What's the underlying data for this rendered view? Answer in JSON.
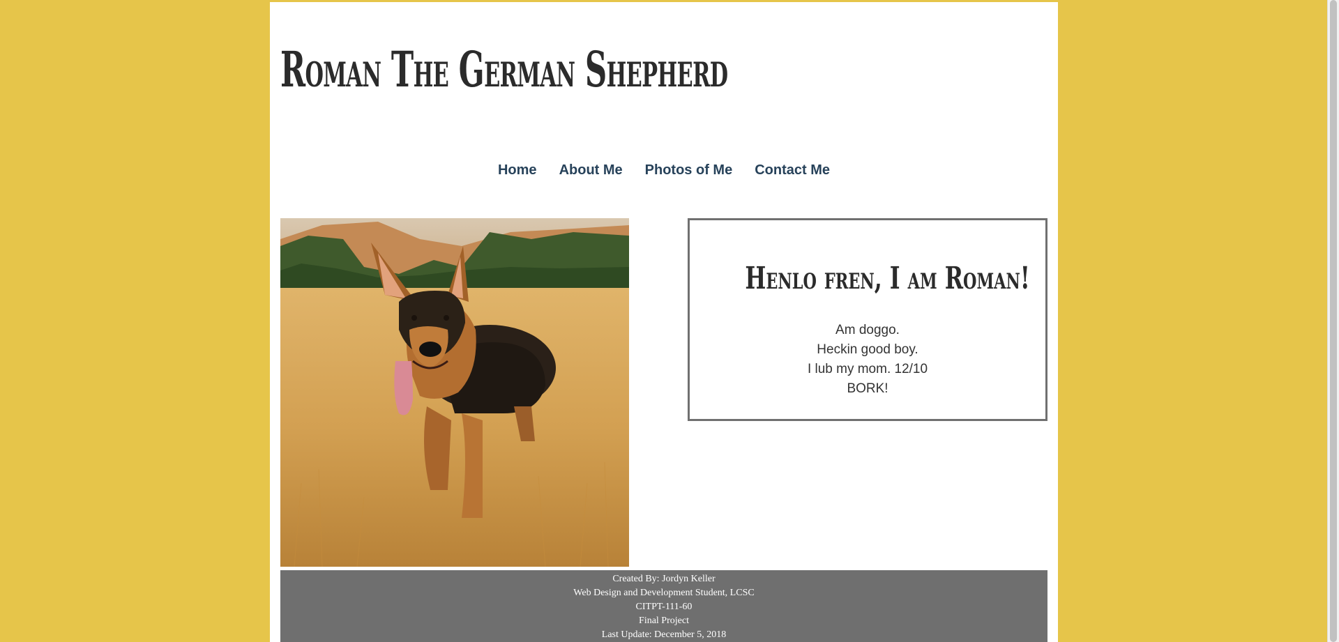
{
  "header": {
    "title": "Roman The German Shepherd"
  },
  "nav": {
    "items": [
      {
        "label": "Home"
      },
      {
        "label": "About Me"
      },
      {
        "label": "Photos of Me"
      },
      {
        "label": "Contact Me"
      }
    ]
  },
  "main": {
    "photo_subject": "German Shepherd standing in golden grass field",
    "intro": {
      "heading": "Henlo fren, I am Roman!",
      "lines": [
        "Am doggo.",
        "Heckin good boy.",
        "I lub my mom. 12/10",
        "BORK!"
      ]
    }
  },
  "footer": {
    "lines": [
      "Created By: Jordyn Keller",
      "Web Design and Development Student, LCSC",
      "CITPT-111-60",
      "Final Project",
      "Last Update: December 5, 2018"
    ]
  },
  "colors": {
    "background": "#e6c54a",
    "nav_text": "#27425a",
    "footer_bg": "#6f6f6f",
    "box_border": "#707070"
  }
}
